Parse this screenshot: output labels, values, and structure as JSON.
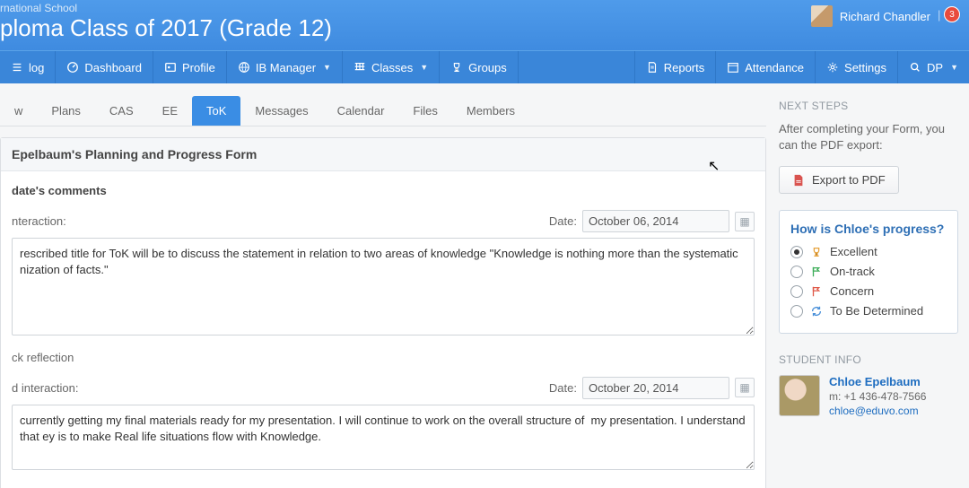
{
  "header": {
    "school": "rnational School",
    "title": "ploma Class of 2017 (Grade 12)",
    "user": "Richard Chandler",
    "notif_count": "3"
  },
  "nav": {
    "left": [
      {
        "label": "log",
        "icon": "list"
      },
      {
        "label": "Dashboard",
        "icon": "gauge"
      },
      {
        "label": "Profile",
        "icon": "id"
      },
      {
        "label": "IB Manager",
        "icon": "globe",
        "dd": true
      },
      {
        "label": "Classes",
        "icon": "grid",
        "dd": true
      },
      {
        "label": "Groups",
        "icon": "trophy"
      }
    ],
    "right": [
      {
        "label": "Reports",
        "icon": "doc"
      },
      {
        "label": "Attendance",
        "icon": "cal"
      },
      {
        "label": "Settings",
        "icon": "gear"
      },
      {
        "label": "DP",
        "icon": "search",
        "dd": true
      }
    ]
  },
  "tabs": [
    "w",
    "Plans",
    "CAS",
    "EE",
    "ToK",
    "Messages",
    "Calendar",
    "Files",
    "Members"
  ],
  "active_tab": "ToK",
  "panel": {
    "title": "Epelbaum's Planning and Progress Form",
    "section": "date's comments",
    "entries": [
      {
        "label": "nteraction:",
        "date_label": "Date:",
        "date": "October 06, 2014",
        "text": "rescribed title for ToK will be to discuss the statement in relation to two areas of knowledge \"Knowledge is nothing more than the systematic nization of facts.\"",
        "rows": 5
      },
      {
        "label": "ck reflection",
        "date_label": "",
        "date": "",
        "text": "",
        "rows": 0
      },
      {
        "label": "d interaction:",
        "date_label": "Date:",
        "date": "October 20, 2014",
        "text": "currently getting my final materials ready for my presentation. I will continue to work on the overall structure of  my presentation. I understand that ey is to make Real life situations flow with Knowledge.",
        "rows": 3
      }
    ]
  },
  "side": {
    "next_h": "NEXT STEPS",
    "next_p": "After completing your Form, you can the PDF export:",
    "export_btn": "Export to PDF",
    "progress_h": "How is Chloe's progress?",
    "progress_opts": [
      {
        "label": "Excellent",
        "icon": "trophy",
        "color": "#e6a23c",
        "sel": true
      },
      {
        "label": "On-track",
        "icon": "flag",
        "color": "#3fae5a",
        "sel": false
      },
      {
        "label": "Concern",
        "icon": "flag",
        "color": "#e05a4a",
        "sel": false
      },
      {
        "label": "To Be Determined",
        "icon": "refresh",
        "color": "#4a90d9",
        "sel": false
      }
    ],
    "student_h": "STUDENT INFO",
    "student": {
      "name": "Chloe Epelbaum",
      "phone": "m: +1 436-478-7566",
      "email": "chloe@eduvo.com"
    }
  }
}
